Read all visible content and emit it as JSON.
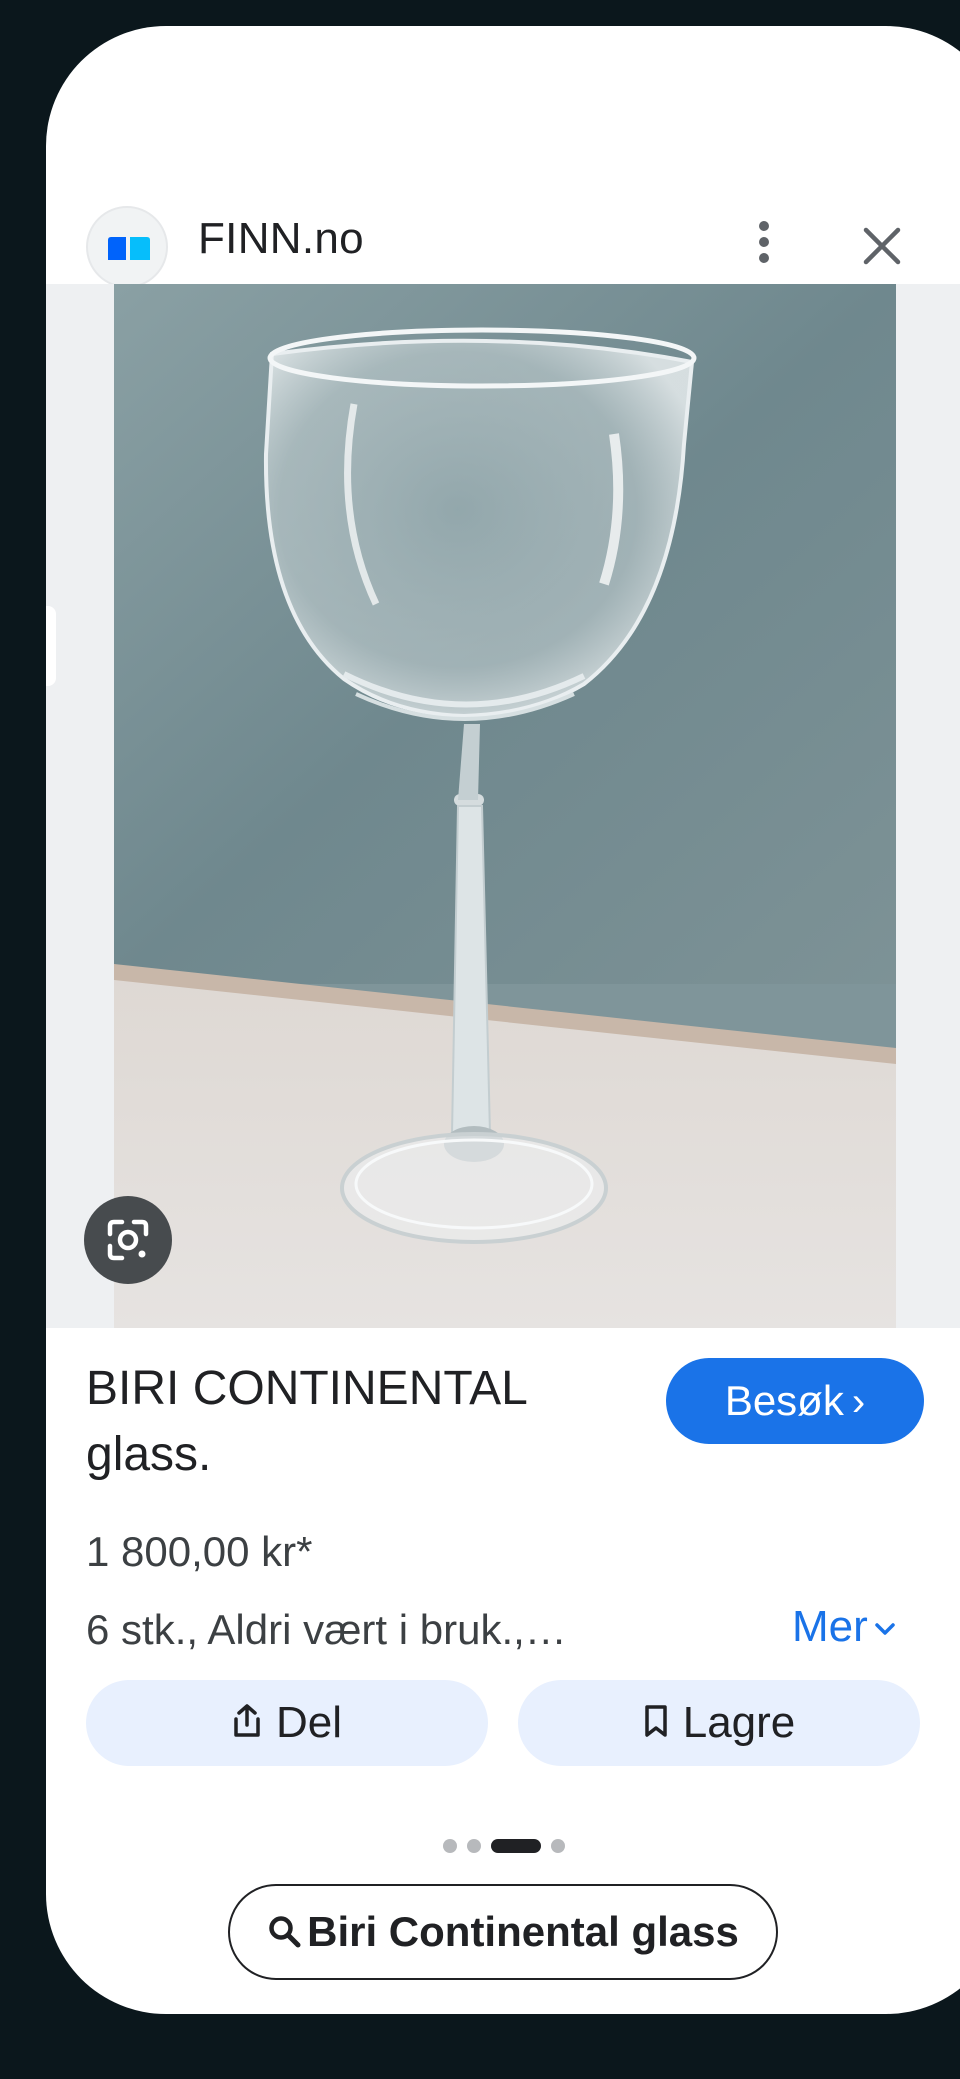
{
  "header": {
    "site_name": "FINN.no"
  },
  "listing": {
    "title_line1": "BIRI CONTINENTAL",
    "title_line2": "glass.",
    "price": "1 800,00 kr*",
    "description": "6 stk., Aldri vært i bruk.,…",
    "more_label": "Mer",
    "visit_label": "Besøk"
  },
  "actions": {
    "share_label": "Del",
    "save_label": "Lagre"
  },
  "pagination": {
    "total": 4,
    "active_index": 2
  },
  "search": {
    "query_label": "Biri Continental glass"
  },
  "icons": {
    "site": "finn-logo-icon",
    "menu": "more-vert-icon",
    "close": "close-icon",
    "lens": "google-lens-icon",
    "share": "share-icon",
    "save": "bookmark-icon",
    "search": "search-icon",
    "more": "chevron-down-icon",
    "visit": "chevron-right-icon"
  },
  "colors": {
    "accent": "#1a73e8",
    "chip_bg": "#e8f0fe",
    "backdrop": "#0b171c"
  }
}
